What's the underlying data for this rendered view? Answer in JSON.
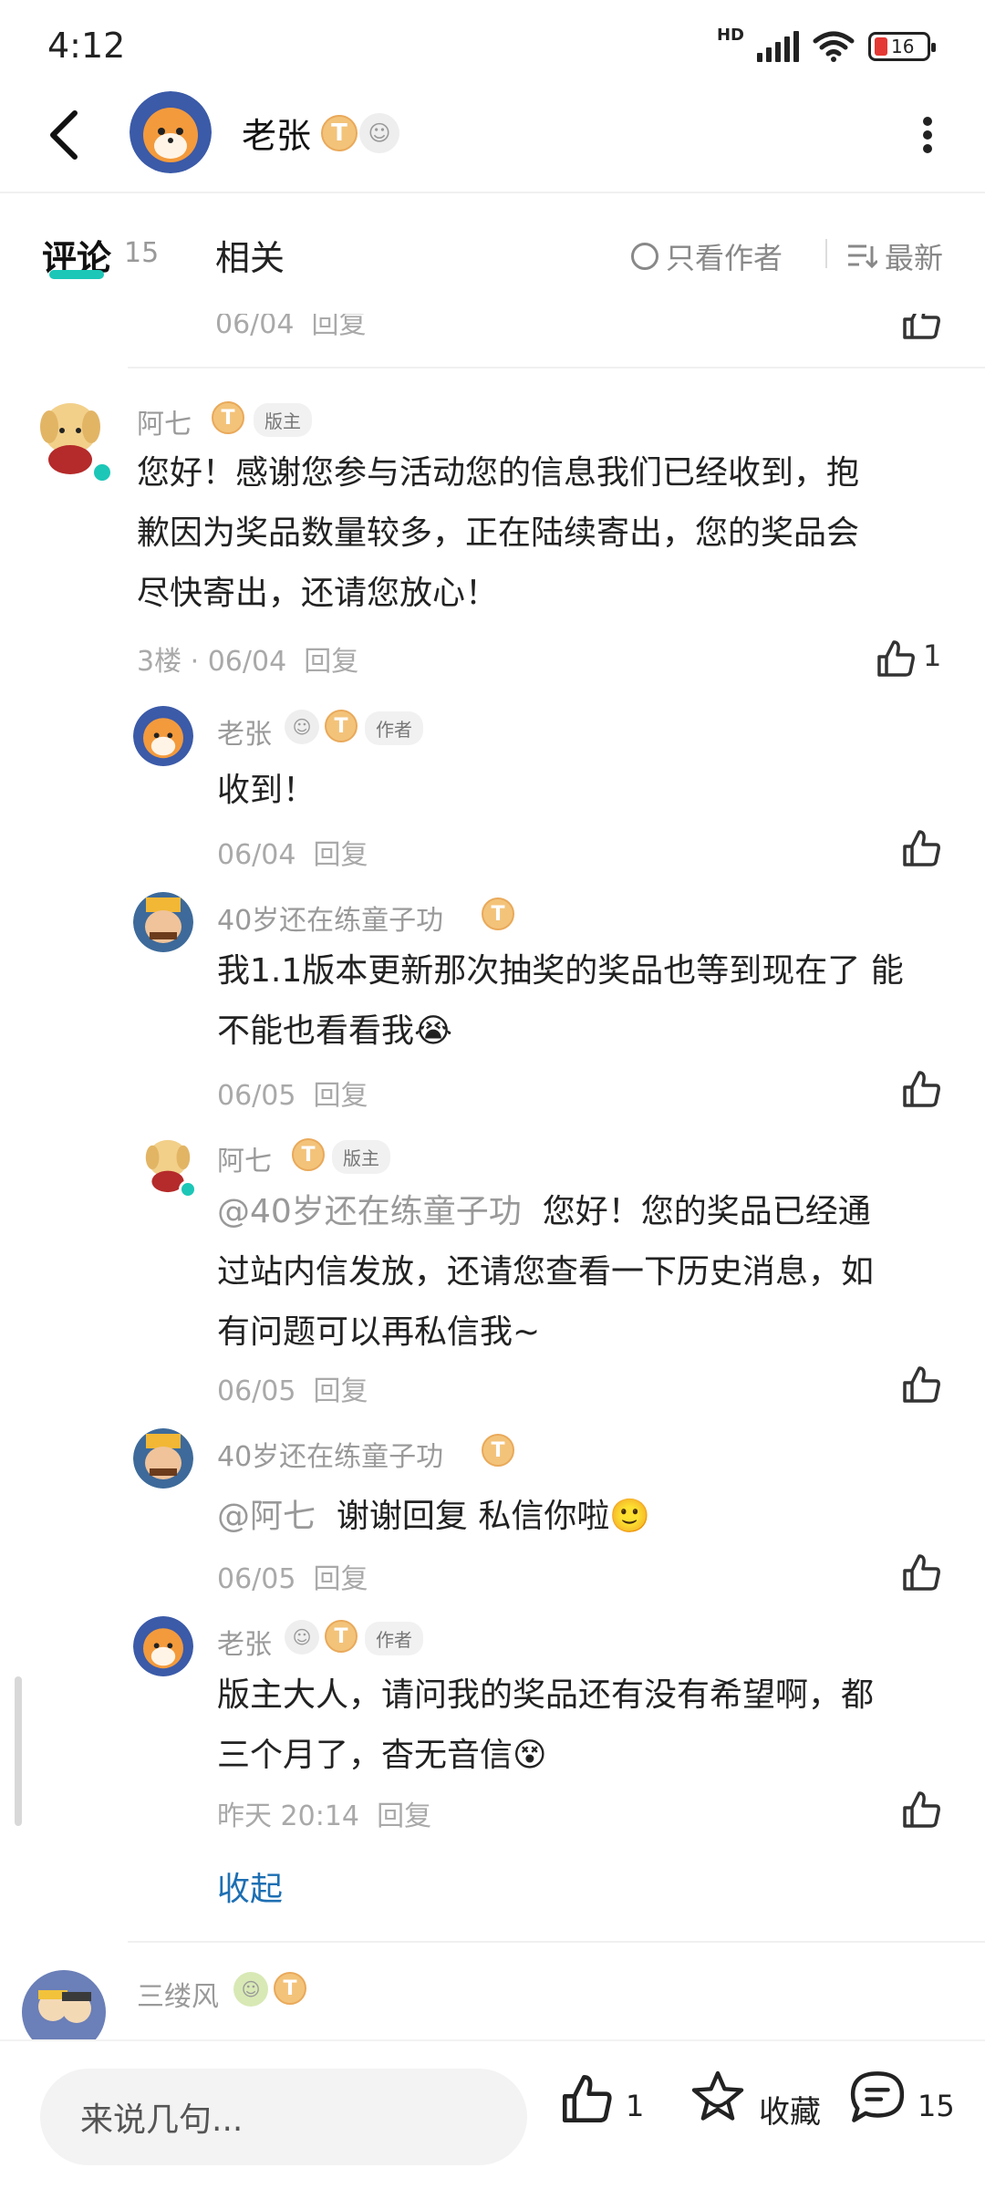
{
  "status": {
    "time": "4:12",
    "network": "HD",
    "battery": "16"
  },
  "header": {
    "name": "老张"
  },
  "tabs": {
    "comments": "评论",
    "comments_count": "15",
    "related": "相关",
    "only_author": "只看作者",
    "sort": "最新"
  },
  "partial_meta": {
    "date": "06/04",
    "reply": "回复"
  },
  "main_comment": {
    "name": "阿七",
    "tag": "版主",
    "text": [
      "您好！感谢您参与活动您的信息我们已经收到，抱",
      "歉因为奖品数量较多，正在陆续寄出，您的奖品会",
      "尽快寄出，还请您放心！"
    ],
    "floor": "3楼",
    "date": "06/04",
    "reply": "回复",
    "likes": "1"
  },
  "replies": [
    {
      "name": "老张",
      "tag": "作者",
      "text": [
        "收到！"
      ],
      "date": "06/04",
      "reply": "回复"
    },
    {
      "name": "40岁还在练童子功",
      "text": [
        "我1.1版本更新那次抽奖的奖品也等到现在了 能",
        "不能也看看我"
      ],
      "date": "06/05",
      "reply": "回复"
    },
    {
      "name": "阿七",
      "tag": "版主",
      "mention": "@40岁还在练童子功",
      "text": [
        "您好！您的奖品已经通",
        "过站内信发放，还请您查看一下历史消息，如",
        "有问题可以再私信我~"
      ],
      "date": "06/05",
      "reply": "回复"
    },
    {
      "name": "40岁还在练童子功",
      "mention": "@阿七",
      "text": [
        "谢谢回复 私信你啦"
      ],
      "date": "06/05",
      "reply": "回复"
    },
    {
      "name": "老张",
      "tag": "作者",
      "text": [
        "版主大人，请问我的奖品还有没有希望啊，都",
        "三个月了，杳无音信"
      ],
      "date": "昨天 20:14",
      "reply": "回复"
    }
  ],
  "collapse": "收起",
  "next_comment": {
    "name": "三缕风"
  },
  "bottom": {
    "placeholder": "来说几句...",
    "likes": "1",
    "favorite": "收藏",
    "comments": "15"
  },
  "colors": {
    "accent": "#1cc7b7",
    "link": "#1d6fb3",
    "badge": "#f3c37a"
  }
}
